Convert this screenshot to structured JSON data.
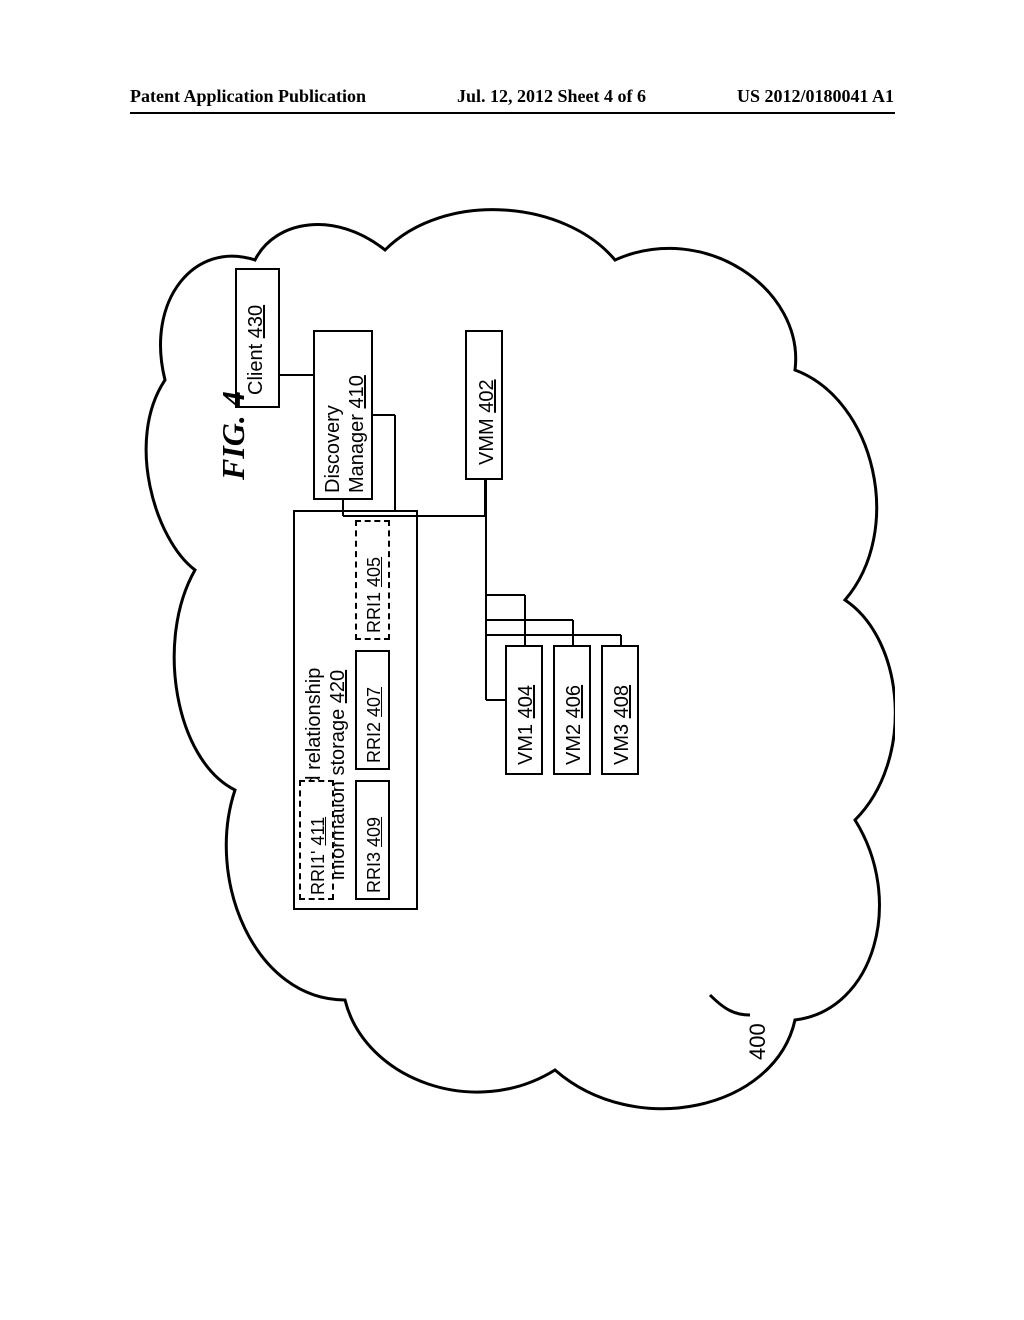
{
  "header": {
    "left": "Patent Application Publication",
    "center": "Jul. 12, 2012  Sheet 4 of 6",
    "right": "US 2012/0180041 A1"
  },
  "boxes": {
    "client": {
      "label": "Client",
      "ref": "430"
    },
    "discovery": {
      "label1": "Discovery",
      "label2": "Manager",
      "ref": "410"
    },
    "vmm": {
      "label": "VMM",
      "ref": "402"
    },
    "rr_storage": {
      "label1": "Resource and relationship",
      "label2": "information storage",
      "ref": "420"
    },
    "rri1": {
      "label": "RRI1",
      "ref": "405"
    },
    "rri2": {
      "label": "RRI2",
      "ref": "407"
    },
    "rri3": {
      "label": "RRI3",
      "ref": "409"
    },
    "rri1p": {
      "label": "RRI1'",
      "ref": "411"
    },
    "vm1": {
      "label": "VM1",
      "ref": "404"
    },
    "vm2": {
      "label": "VM2",
      "ref": "406"
    },
    "vm3": {
      "label": "VM3",
      "ref": "408"
    }
  },
  "cloud_ref": "400",
  "figure_label": "FIG. 4"
}
